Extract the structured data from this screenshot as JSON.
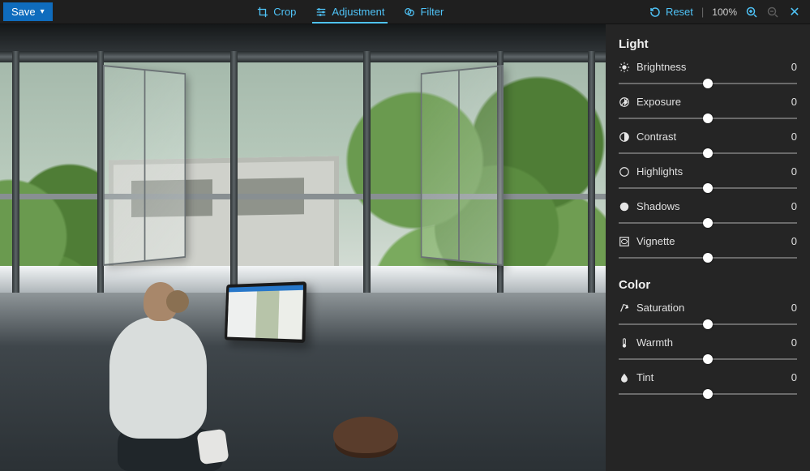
{
  "toolbar": {
    "save_label": "Save",
    "tabs": [
      {
        "id": "crop",
        "label": "Crop",
        "active": false
      },
      {
        "id": "adjustment",
        "label": "Adjustment",
        "active": true
      },
      {
        "id": "filter",
        "label": "Filter",
        "active": false
      }
    ],
    "reset_label": "Reset",
    "zoom_label": "100%",
    "accent": "#4fc3f7"
  },
  "panel": {
    "light": {
      "title": "Light",
      "sliders": [
        {
          "id": "brightness",
          "label": "Brightness",
          "value": 0,
          "min": -100,
          "max": 100
        },
        {
          "id": "exposure",
          "label": "Exposure",
          "value": 0,
          "min": -100,
          "max": 100
        },
        {
          "id": "contrast",
          "label": "Contrast",
          "value": 0,
          "min": -100,
          "max": 100
        },
        {
          "id": "highlights",
          "label": "Highlights",
          "value": 0,
          "min": -100,
          "max": 100
        },
        {
          "id": "shadows",
          "label": "Shadows",
          "value": 0,
          "min": -100,
          "max": 100
        },
        {
          "id": "vignette",
          "label": "Vignette",
          "value": 0,
          "min": -100,
          "max": 100
        }
      ]
    },
    "color": {
      "title": "Color",
      "sliders": [
        {
          "id": "saturation",
          "label": "Saturation",
          "value": 0,
          "min": -100,
          "max": 100
        },
        {
          "id": "warmth",
          "label": "Warmth",
          "value": 0,
          "min": -100,
          "max": 100
        },
        {
          "id": "tint",
          "label": "Tint",
          "value": 0,
          "min": -100,
          "max": 100
        }
      ]
    }
  }
}
